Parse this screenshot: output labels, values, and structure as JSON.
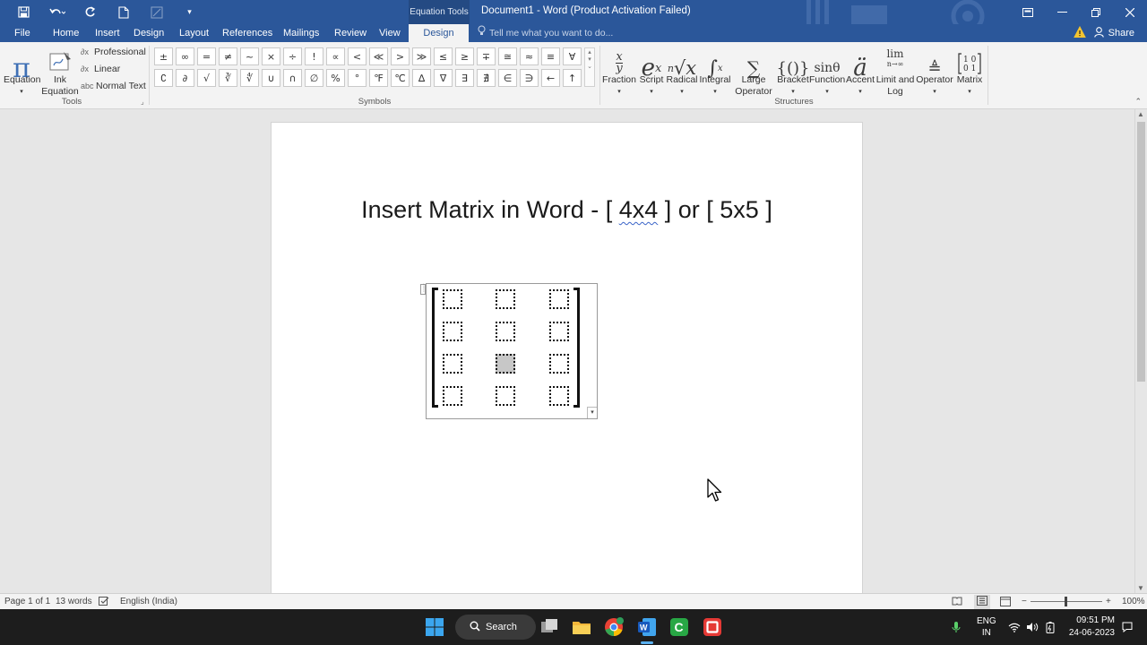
{
  "titlebar": {
    "context_tab": "Equation Tools",
    "title": "Document1 - Word (Product Activation Failed)"
  },
  "tabs": {
    "file": "File",
    "home": "Home",
    "insert": "Insert",
    "design": "Design",
    "layout": "Layout",
    "references": "References",
    "mailings": "Mailings",
    "review": "Review",
    "view": "View",
    "eq_design": "Design",
    "tellme": "Tell me what you want to do...",
    "share": "Share"
  },
  "ribbon": {
    "tools": {
      "label": "Tools",
      "equation": "Equation",
      "ink_equation": [
        "Ink",
        "Equation"
      ],
      "professional": "Professional",
      "linear": "Linear",
      "normal_text": "Normal Text"
    },
    "symbols": {
      "label": "Symbols",
      "row1": [
        "±",
        "∞",
        "=",
        "≠",
        "~",
        "×",
        "÷",
        "!",
        "∝",
        "<",
        "≪",
        ">",
        "≫",
        "≤",
        "≥",
        "∓",
        "≅",
        "≈",
        "≡",
        "∀"
      ],
      "row2": [
        "∁",
        "∂",
        "√",
        "∛",
        "∜",
        "∪",
        "∩",
        "∅",
        "%",
        "°",
        "℉",
        "℃",
        "∆",
        "∇",
        "∃",
        "∄",
        "∈",
        "∋",
        "←",
        "↑"
      ]
    },
    "structures": {
      "label": "Structures",
      "fraction": "Fraction",
      "script": "Script",
      "radical": "Radical",
      "integral": "Integral",
      "large_operator": [
        "Large",
        "Operator"
      ],
      "bracket": "Bracket",
      "function": "Function",
      "accent": "Accent",
      "limit_log": [
        "Limit and",
        "Log"
      ],
      "operator": "Operator",
      "matrix": "Matrix"
    }
  },
  "document": {
    "heading_before": "Insert Matrix in Word - [ ",
    "heading_squiggle": "4x4",
    "heading_after": " ] or [ 5x5 ]",
    "matrix": {
      "rows": 4,
      "cols": 3,
      "selected_cell": [
        2,
        1
      ]
    }
  },
  "statusbar": {
    "page": "Page 1 of 1",
    "words": "13 words",
    "language": "English (India)",
    "zoom": "100%"
  },
  "taskbar": {
    "search": "Search",
    "lang_line1": "ENG",
    "lang_line2": "IN",
    "time": "09:51 PM",
    "date": "24-06-2023"
  }
}
